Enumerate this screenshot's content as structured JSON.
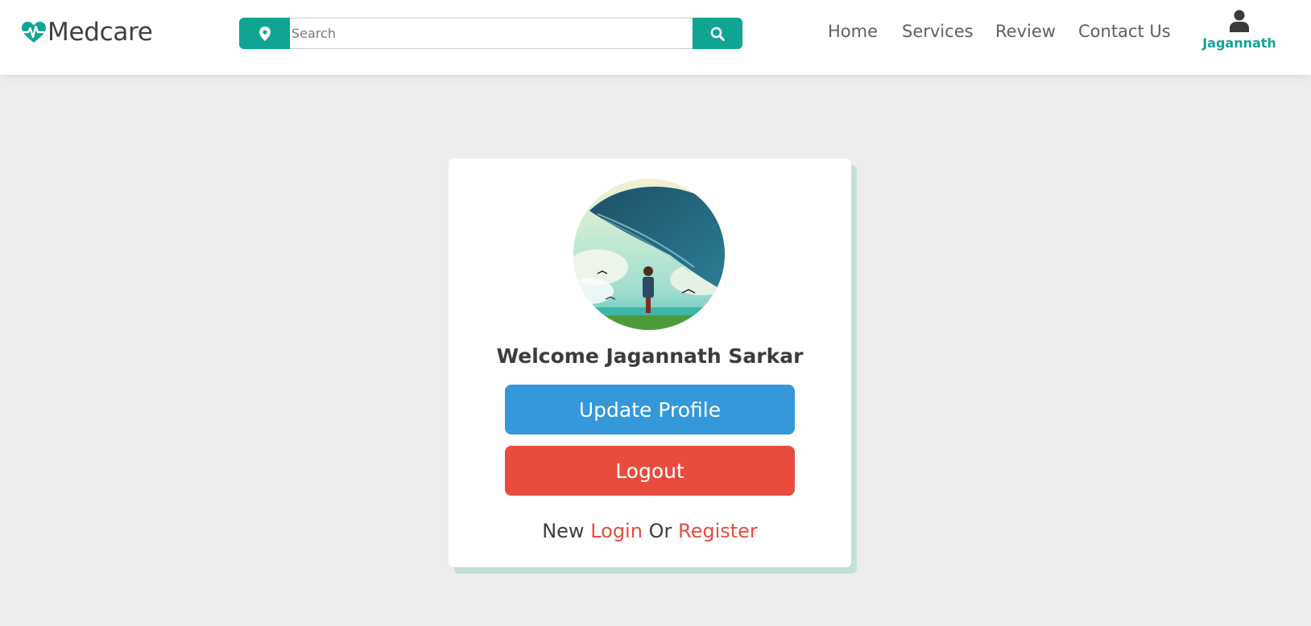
{
  "brand": {
    "name": "Medcare",
    "accent_color": "#0fa592"
  },
  "header": {
    "search": {
      "placeholder": "Search",
      "value": "",
      "location_icon": "map-pin-icon",
      "button_icon": "search-icon"
    },
    "nav": [
      {
        "label": "Home"
      },
      {
        "label": "Services"
      },
      {
        "label": "Review"
      },
      {
        "label": "Contact Us"
      }
    ],
    "user": {
      "name": "Jagannath",
      "icon": "user-icon"
    }
  },
  "profile_card": {
    "avatar_alt": "profile picture",
    "welcome_text": "Welcome Jagannath Sarkar",
    "update_button": {
      "label": "Update Profile",
      "color": "#3498db"
    },
    "logout_button": {
      "label": "Logout",
      "color": "#e84c3c"
    },
    "footer": {
      "prefix": "New",
      "login_label": "Login",
      "middle": "Or",
      "register_label": "Register"
    }
  }
}
